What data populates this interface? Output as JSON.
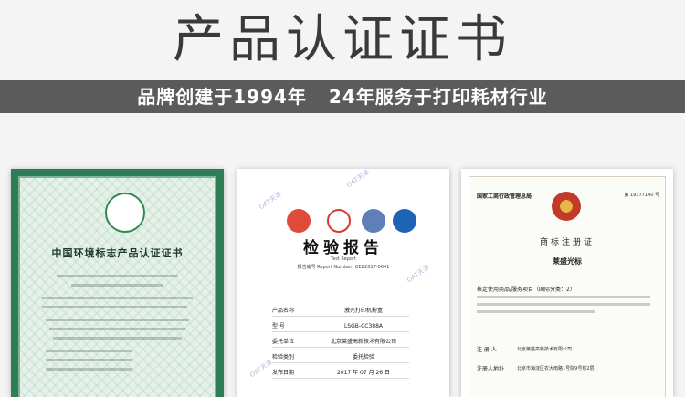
{
  "header": {
    "title": "产品认证证书",
    "banner_left": "品牌创建于1994年",
    "banner_right": "24年服务于打印耗材行业"
  },
  "cards": {
    "environment": {
      "title": "中国环境标志产品认证证书"
    },
    "inspection": {
      "title": "检验报告",
      "subtitle": "Test Report",
      "report_no": "报告编号 Report Number: OEZ2017-0641",
      "rows": [
        {
          "label": "产品名称",
          "value": "激光打印机粉盒"
        },
        {
          "label": "型 号",
          "value": "LSGB-CC388A"
        },
        {
          "label": "委托单位",
          "value": "北京莱盛高新技术有限公司"
        },
        {
          "label": "检验类别",
          "value": "委托检验"
        },
        {
          "label": "发布日期",
          "value": "2017 年 07 月 26 日"
        }
      ],
      "watermark": "OAT天津"
    },
    "trademark": {
      "registry_logo": "国家工商行政管理总局",
      "number": "第 19377140 号",
      "title": "商标注册证",
      "brand": "莱盛光标",
      "service_line": "核定使用商品/服务项目（国际分类：2）",
      "registrant_label": "注 册 人",
      "registrant_value": "北京莱盛高新技术有限公司",
      "address_label": "注册人地址",
      "address_value": "北京市海淀区农大南路1号院9号楼2层"
    }
  }
}
